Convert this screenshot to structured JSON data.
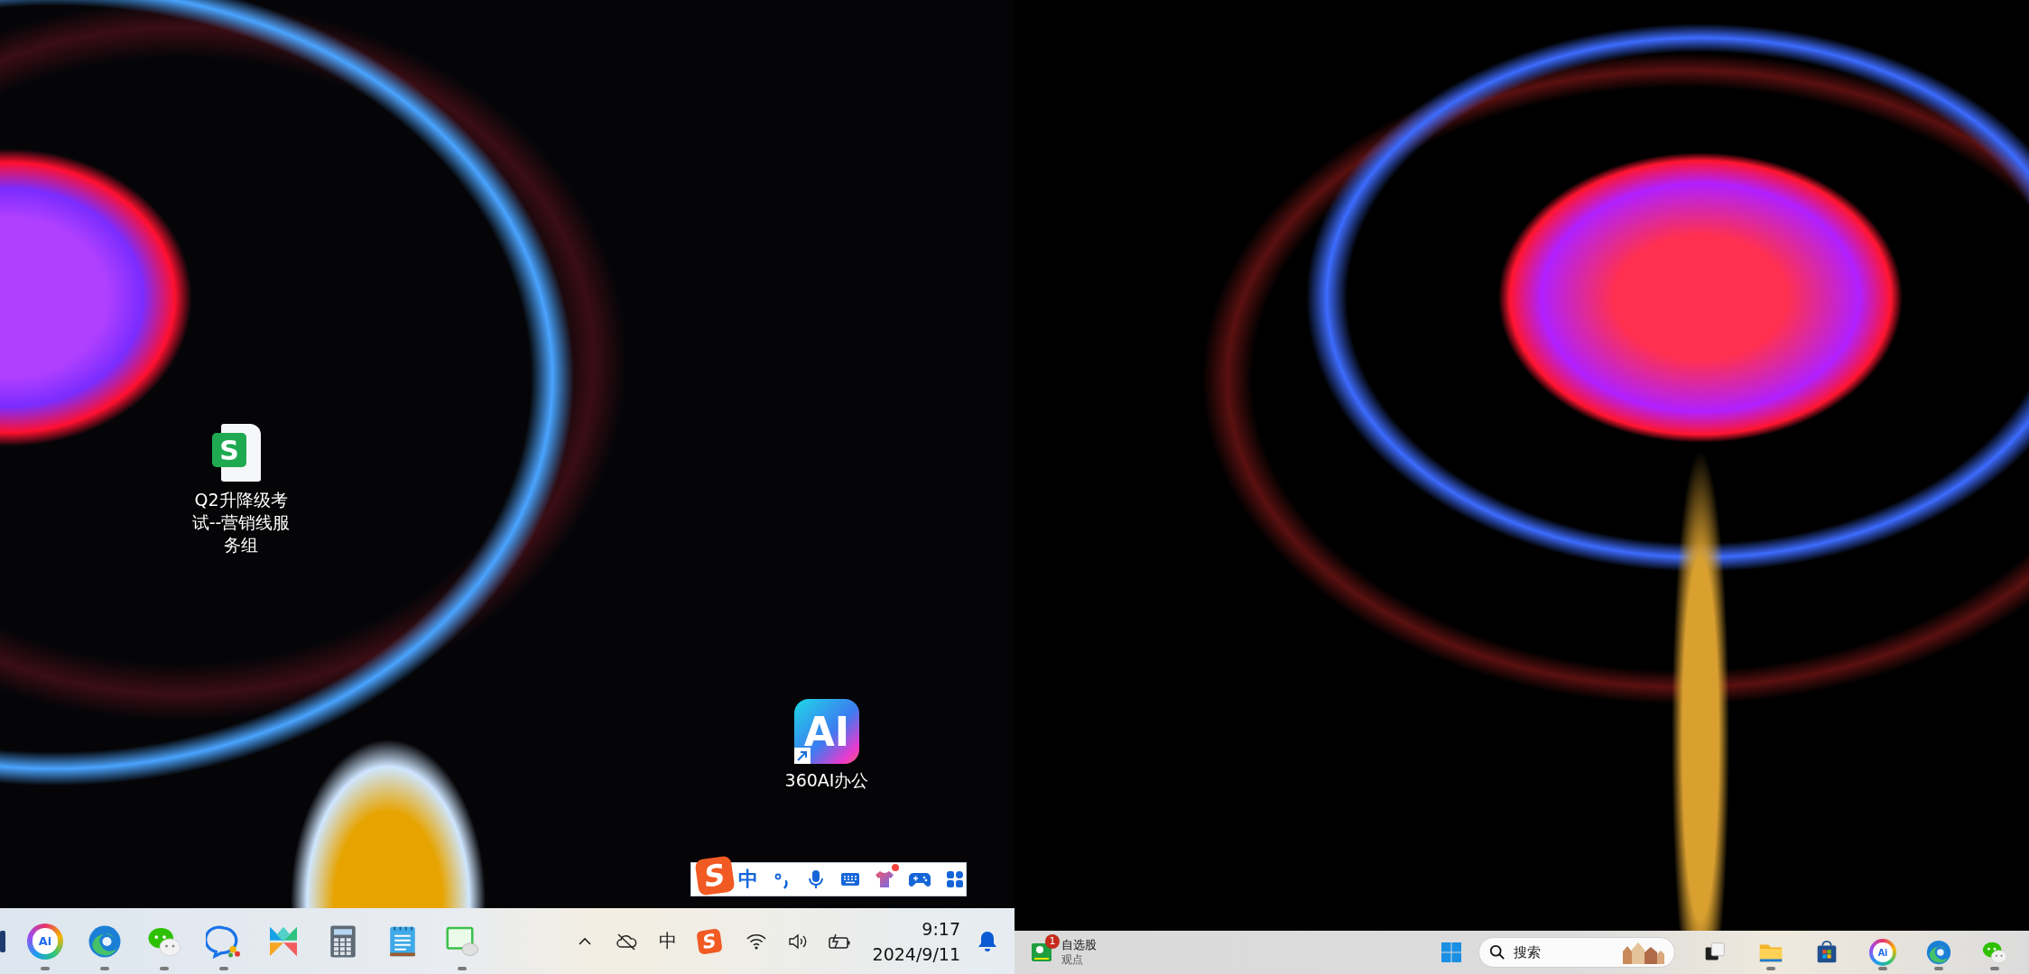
{
  "left_screen": {
    "desktop_icons": [
      {
        "kind": "spreadsheet",
        "glyph": "S",
        "label": "Q2升降级考试--营销线服务组"
      },
      {
        "kind": "ai_shortcut",
        "glyph": "AI",
        "label": "360AI办公"
      }
    ],
    "ime_toolbar": [
      {
        "kind": "logo",
        "glyph": "S"
      },
      {
        "kind": "mode",
        "text": "中"
      },
      {
        "kind": "punct"
      },
      {
        "kind": "mic"
      },
      {
        "kind": "keyboard"
      },
      {
        "kind": "skin",
        "dot": true
      },
      {
        "kind": "game"
      },
      {
        "kind": "apps"
      }
    ],
    "taskbar": {
      "apps": [
        {
          "kind": "partial",
          "running": false
        },
        {
          "kind": "ai",
          "glyph": "Ai",
          "running": true
        },
        {
          "kind": "edge",
          "running": true
        },
        {
          "kind": "wechat",
          "running": true
        },
        {
          "kind": "chat",
          "running": true
        },
        {
          "kind": "photos",
          "running": false
        },
        {
          "kind": "calculator",
          "running": false
        },
        {
          "kind": "notepad",
          "running": false
        },
        {
          "kind": "remote_chat",
          "running": true
        }
      ],
      "tray": [
        {
          "kind": "chevron"
        },
        {
          "kind": "cloud_off"
        },
        {
          "kind": "ime",
          "text": "中"
        },
        {
          "kind": "sogou",
          "glyph": "S"
        },
        {
          "kind": "wifi"
        },
        {
          "kind": "volume"
        },
        {
          "kind": "pen_battery"
        }
      ],
      "clock": {
        "time": "9:17",
        "date": "2024/9/11"
      }
    }
  },
  "right_screen": {
    "taskbar": {
      "widget": {
        "title": "自选股",
        "subtitle": "观点",
        "badge": "1"
      },
      "search": {
        "placeholder": "搜索"
      },
      "apps": [
        {
          "kind": "task_view",
          "running": false
        },
        {
          "kind": "explorer",
          "running": true
        },
        {
          "kind": "store",
          "running": false
        },
        {
          "kind": "ai",
          "glyph": "Ai",
          "running": true
        },
        {
          "kind": "edge",
          "running": true
        },
        {
          "kind": "wechat",
          "running": true
        }
      ]
    }
  }
}
